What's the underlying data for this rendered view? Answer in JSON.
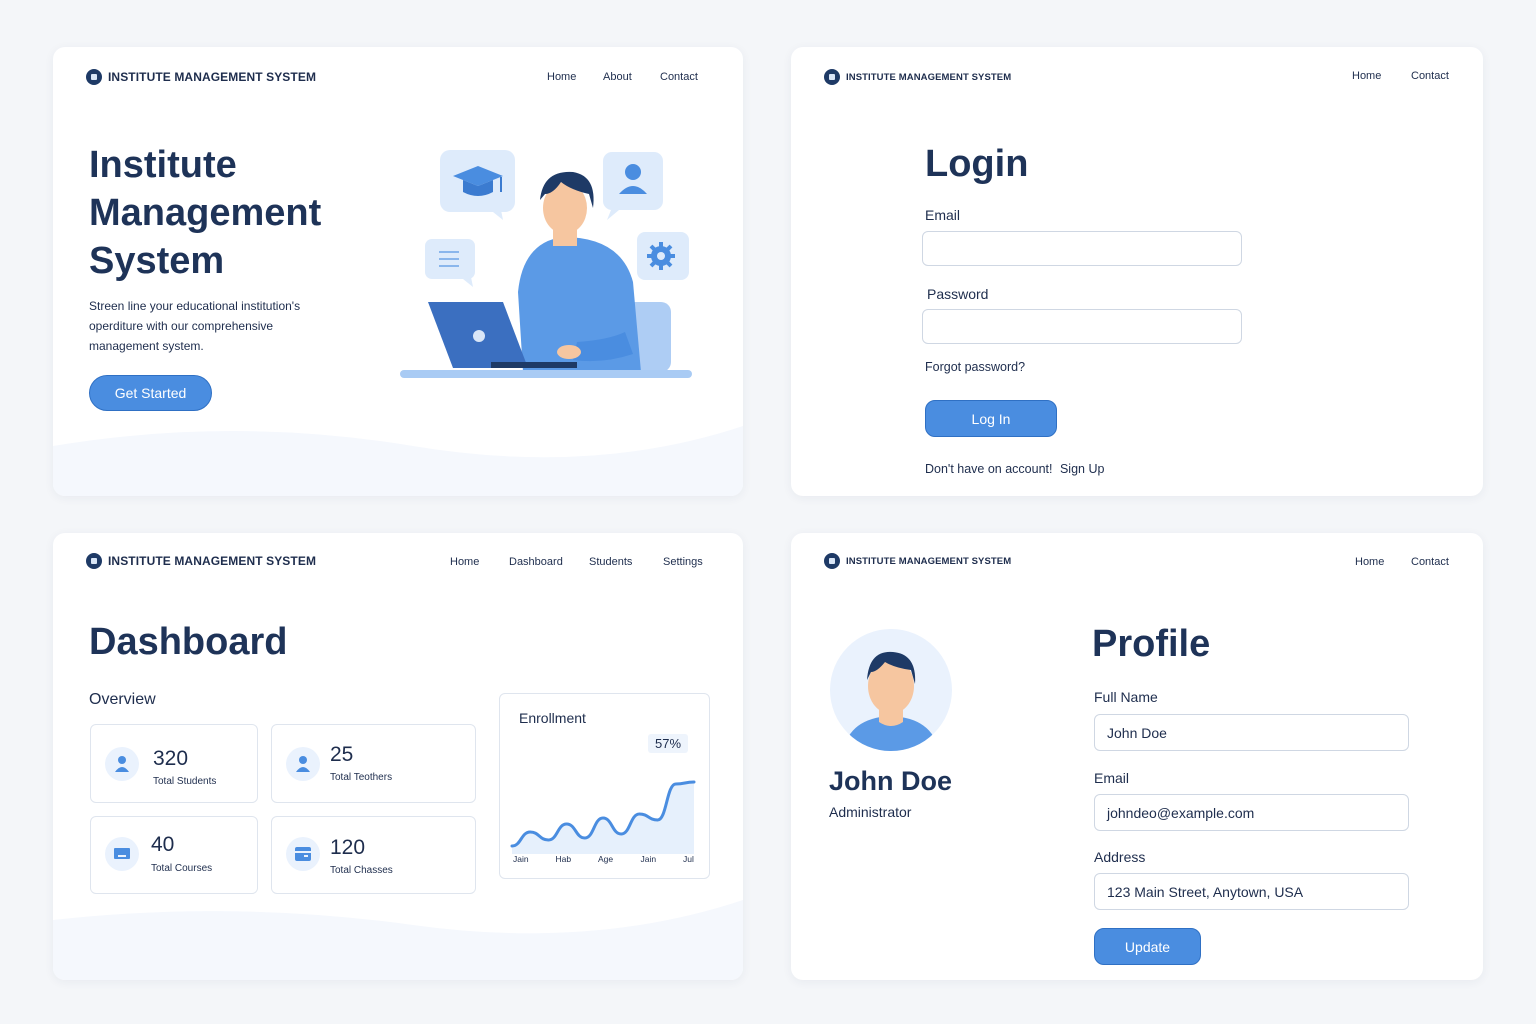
{
  "brand": "INSTITUTE MANAGEMENT SYSTEM",
  "colors": {
    "accent": "#4a8de0",
    "heading": "#1e3358",
    "background": "#f4f6f9"
  },
  "landing": {
    "nav": [
      "Home",
      "About",
      "Contact"
    ],
    "title_lines": [
      "Institute",
      "Management",
      "System"
    ],
    "description_lines": [
      "Streen line your educational institution's",
      "operditure with our comprehensive",
      "management system."
    ],
    "cta": "Get Started"
  },
  "login": {
    "nav": [
      "Home",
      "Contact"
    ],
    "title": "Login",
    "email_label": "Email",
    "password_label": "Password",
    "forgot": "Forgot password?",
    "button": "Log In",
    "signup_prompt": "Don't have on account!",
    "signup_link": "Sign Up"
  },
  "dashboard": {
    "nav": [
      "Home",
      "Dashboard",
      "Students",
      "Settings"
    ],
    "title": "Dashboard",
    "overview_label": "Overview",
    "stats": [
      {
        "value": "320",
        "label": "Total Students",
        "icon": "user-icon"
      },
      {
        "value": "25",
        "label": "Total Teothers",
        "icon": "user-icon"
      },
      {
        "value": "40",
        "label": "Total Courses",
        "icon": "laptop-icon"
      },
      {
        "value": "120",
        "label": "Total Chasses",
        "icon": "calendar-icon"
      }
    ],
    "chart_title": "Enrollment",
    "chart_badge": "57%"
  },
  "chart_data": {
    "type": "area",
    "title": "Enrollment",
    "x": [
      "Jain",
      "Hab",
      "Age",
      "Jain",
      "Jul"
    ],
    "series": [
      {
        "values": [
          8,
          22,
          14,
          30,
          16,
          36,
          20,
          40,
          34,
          70,
          72
        ]
      }
    ],
    "ylim": [
      0,
      100
    ],
    "annotation": "57%",
    "grid": false
  },
  "profile": {
    "nav": [
      "Home",
      "Contact"
    ],
    "title": "Profile",
    "name": "John Doe",
    "role": "Administrator",
    "full_name_label": "Full Name",
    "full_name_value": "John Doe",
    "email_label": "Email",
    "email_value": "johndeo@example.com",
    "address_label": "Address",
    "address_value": "123 Main Street, Anytown, USA",
    "button": "Update"
  }
}
